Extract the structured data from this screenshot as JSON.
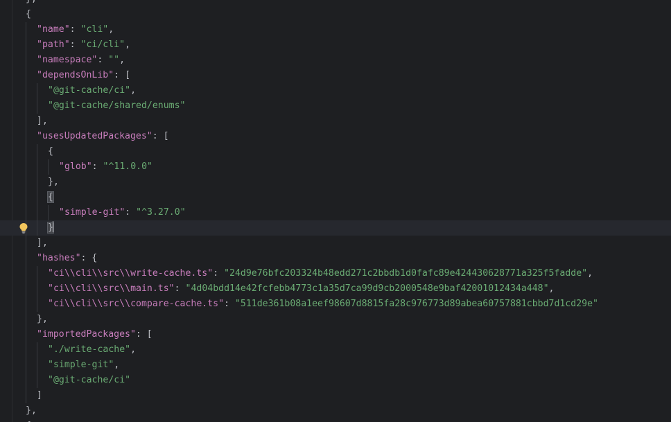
{
  "editor": {
    "lines": [
      {
        "id": "l0",
        "indent": 1,
        "parts": [
          [
            "p",
            "},"
          ]
        ]
      },
      {
        "id": "l1",
        "indent": 1,
        "parts": [
          [
            "p",
            "{"
          ]
        ]
      },
      {
        "id": "l2",
        "indent": 2,
        "parts": [
          [
            "k",
            "\"name\""
          ],
          [
            "p",
            ": "
          ],
          [
            "s",
            "\"cli\""
          ],
          [
            "p",
            ","
          ]
        ]
      },
      {
        "id": "l3",
        "indent": 2,
        "parts": [
          [
            "k",
            "\"path\""
          ],
          [
            "p",
            ": "
          ],
          [
            "s",
            "\"ci/cli\""
          ],
          [
            "p",
            ","
          ]
        ]
      },
      {
        "id": "l4",
        "indent": 2,
        "parts": [
          [
            "k",
            "\"namespace\""
          ],
          [
            "p",
            ": "
          ],
          [
            "s",
            "\"\""
          ],
          [
            "p",
            ","
          ]
        ]
      },
      {
        "id": "l5",
        "indent": 2,
        "parts": [
          [
            "k",
            "\"dependsOnLib\""
          ],
          [
            "p",
            ": ["
          ]
        ]
      },
      {
        "id": "l6",
        "indent": 3,
        "parts": [
          [
            "s",
            "\"@git-cache/ci\""
          ],
          [
            "p",
            ","
          ]
        ]
      },
      {
        "id": "l7",
        "indent": 3,
        "parts": [
          [
            "s",
            "\"@git-cache/shared/enums\""
          ]
        ]
      },
      {
        "id": "l8",
        "indent": 2,
        "parts": [
          [
            "p",
            "],"
          ]
        ]
      },
      {
        "id": "l9",
        "indent": 2,
        "parts": [
          [
            "k",
            "\"usesUpdatedPackages\""
          ],
          [
            "p",
            ": ["
          ]
        ]
      },
      {
        "id": "l10",
        "indent": 3,
        "parts": [
          [
            "p",
            "{"
          ]
        ]
      },
      {
        "id": "l11",
        "indent": 4,
        "parts": [
          [
            "k",
            "\"glob\""
          ],
          [
            "p",
            ": "
          ],
          [
            "s",
            "\"^11.0.0\""
          ]
        ]
      },
      {
        "id": "l12",
        "indent": 3,
        "parts": [
          [
            "p",
            "},"
          ]
        ]
      },
      {
        "id": "l13",
        "indent": 3,
        "parts": [
          [
            "hl",
            "{"
          ]
        ]
      },
      {
        "id": "l14",
        "indent": 4,
        "parts": [
          [
            "k",
            "\"simple-git\""
          ],
          [
            "p",
            ": "
          ],
          [
            "s",
            "\"^3.27.0\""
          ]
        ]
      },
      {
        "id": "l15",
        "indent": 3,
        "parts": [
          [
            "hlc",
            "}"
          ]
        ],
        "current": true,
        "bulb": true
      },
      {
        "id": "l16",
        "indent": 2,
        "parts": [
          [
            "p",
            "],"
          ]
        ]
      },
      {
        "id": "l17",
        "indent": 2,
        "parts": [
          [
            "k",
            "\"hashes\""
          ],
          [
            "p",
            ": {"
          ]
        ]
      },
      {
        "id": "l18",
        "indent": 3,
        "parts": [
          [
            "k",
            "\"ci\\\\cli\\\\src\\\\write-cache.ts\""
          ],
          [
            "p",
            ": "
          ],
          [
            "s",
            "\"24d9e76bfc203324b48edd271c2bbdb1d0fafc89e424430628771a325f5fadde\""
          ],
          [
            "p",
            ","
          ]
        ]
      },
      {
        "id": "l19",
        "indent": 3,
        "parts": [
          [
            "k",
            "\"ci\\\\cli\\\\src\\\\main.ts\""
          ],
          [
            "p",
            ": "
          ],
          [
            "s",
            "\"4d04bdd14e42fcfebb4773c1a35d7ca99d9cb2000548e9baf42001012434a448\""
          ],
          [
            "p",
            ","
          ]
        ]
      },
      {
        "id": "l20",
        "indent": 3,
        "parts": [
          [
            "k",
            "\"ci\\\\cli\\\\src\\\\compare-cache.ts\""
          ],
          [
            "p",
            ": "
          ],
          [
            "s",
            "\"511de361b08a1eef98607d8815fa28c976773d89abea60757881cbbd7d1cd29e\""
          ]
        ]
      },
      {
        "id": "l21",
        "indent": 2,
        "parts": [
          [
            "p",
            "},"
          ]
        ]
      },
      {
        "id": "l22",
        "indent": 2,
        "parts": [
          [
            "k",
            "\"importedPackages\""
          ],
          [
            "p",
            ": ["
          ]
        ]
      },
      {
        "id": "l23",
        "indent": 3,
        "parts": [
          [
            "s",
            "\"./write-cache\""
          ],
          [
            "p",
            ","
          ]
        ]
      },
      {
        "id": "l24",
        "indent": 3,
        "parts": [
          [
            "s",
            "\"simple-git\""
          ],
          [
            "p",
            ","
          ]
        ]
      },
      {
        "id": "l25",
        "indent": 3,
        "parts": [
          [
            "s",
            "\"@git-cache/ci\""
          ]
        ]
      },
      {
        "id": "l26",
        "indent": 2,
        "parts": [
          [
            "p",
            "]"
          ]
        ]
      },
      {
        "id": "l27",
        "indent": 1,
        "parts": [
          [
            "p",
            "},"
          ]
        ]
      },
      {
        "id": "l28",
        "indent": 1,
        "parts": [
          [
            "p",
            "{"
          ]
        ]
      }
    ],
    "intention_icon": "lightbulb-icon",
    "colors": {
      "background": "#1e1f22",
      "key": "#c77dbb",
      "string": "#6aab73",
      "punctuation": "#bcbec4",
      "current_line": "#26282e",
      "bulb": "#f2c55c"
    }
  }
}
